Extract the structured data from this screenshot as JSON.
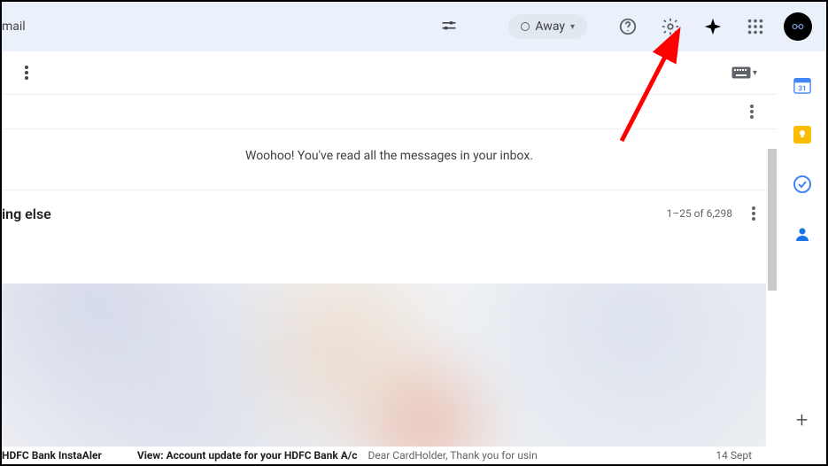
{
  "header": {
    "left_text": "mail",
    "status_label": "Away"
  },
  "section1": {
    "empty_message": "Woohoo! You've read all the messages in your inbox."
  },
  "section2": {
    "title": "ing else",
    "page_count": "1–25 of 6,298"
  },
  "bottom": {
    "sender": "HDFC Bank InstaAler",
    "subject_prefix": "View: ",
    "subject": "Account update for your HDFC Bank A/c",
    "preview": "Dear CardHolder, Thank you for usin",
    "date": "14 Sept"
  },
  "side": {
    "calendar_day": "31",
    "plus": "+"
  }
}
